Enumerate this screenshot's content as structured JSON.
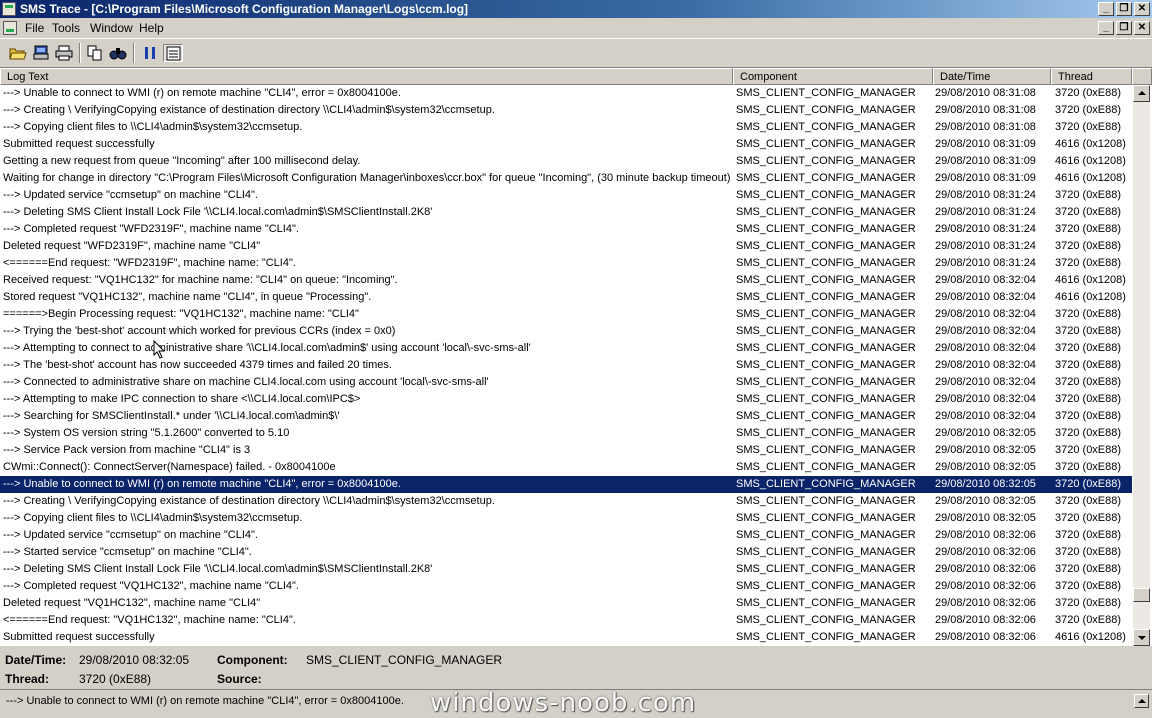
{
  "window": {
    "title": "SMS Trace - [C:\\Program Files\\Microsoft Configuration Manager\\Logs\\ccm.log]",
    "buttons": [
      "_",
      "❐",
      "✕"
    ]
  },
  "menu": {
    "items": [
      "File",
      "Tools",
      "Window",
      "Help"
    ]
  },
  "toolbar": {
    "icons": [
      "open-icon",
      "print-preview-icon",
      "print-icon",
      "copy-icon",
      "find-icon",
      "pause-icon",
      "highlight-icon"
    ]
  },
  "columns": [
    "Log Text",
    "Component",
    "Date/Time",
    "Thread"
  ],
  "rows": [
    {
      "text": "---> Unable to connect to WMI (r) on remote machine \"CLI4\", error = 0x8004100e.",
      "component": "SMS_CLIENT_CONFIG_MANAGER",
      "datetime": "29/08/2010 08:31:08",
      "thread": "3720 (0xE88)"
    },
    {
      "text": "---> Creating \\ VerifyingCopying existance of destination directory \\\\CLI4\\admin$\\system32\\ccmsetup.",
      "component": "SMS_CLIENT_CONFIG_MANAGER",
      "datetime": "29/08/2010 08:31:08",
      "thread": "3720 (0xE88)"
    },
    {
      "text": "---> Copying client files to \\\\CLI4\\admin$\\system32\\ccmsetup.",
      "component": "SMS_CLIENT_CONFIG_MANAGER",
      "datetime": "29/08/2010 08:31:08",
      "thread": "3720 (0xE88)"
    },
    {
      "text": "Submitted request successfully",
      "component": "SMS_CLIENT_CONFIG_MANAGER",
      "datetime": "29/08/2010 08:31:09",
      "thread": "4616 (0x1208)"
    },
    {
      "text": "Getting a new request from queue \"Incoming\" after 100 millisecond delay.",
      "component": "SMS_CLIENT_CONFIG_MANAGER",
      "datetime": "29/08/2010 08:31:09",
      "thread": "4616 (0x1208)"
    },
    {
      "text": "Waiting for change in directory \"C:\\Program Files\\Microsoft Configuration Manager\\inboxes\\ccr.box\" for queue \"Incoming\", (30 minute backup timeout).",
      "component": "SMS_CLIENT_CONFIG_MANAGER",
      "datetime": "29/08/2010 08:31:09",
      "thread": "4616 (0x1208)"
    },
    {
      "text": "---> Updated service \"ccmsetup\" on machine \"CLI4\".",
      "component": "SMS_CLIENT_CONFIG_MANAGER",
      "datetime": "29/08/2010 08:31:24",
      "thread": "3720 (0xE88)"
    },
    {
      "text": "---> Deleting SMS Client Install Lock File '\\\\CLI4.local.com\\admin$\\SMSClientInstall.2K8'",
      "component": "SMS_CLIENT_CONFIG_MANAGER",
      "datetime": "29/08/2010 08:31:24",
      "thread": "3720 (0xE88)"
    },
    {
      "text": "---> Completed request \"WFD2319F\", machine name \"CLI4\".",
      "component": "SMS_CLIENT_CONFIG_MANAGER",
      "datetime": "29/08/2010 08:31:24",
      "thread": "3720 (0xE88)"
    },
    {
      "text": "Deleted request \"WFD2319F\", machine name \"CLI4\"",
      "component": "SMS_CLIENT_CONFIG_MANAGER",
      "datetime": "29/08/2010 08:31:24",
      "thread": "3720 (0xE88)"
    },
    {
      "text": "<======End request: \"WFD2319F\", machine name: \"CLI4\".",
      "component": "SMS_CLIENT_CONFIG_MANAGER",
      "datetime": "29/08/2010 08:31:24",
      "thread": "3720 (0xE88)"
    },
    {
      "text": "Received request: \"VQ1HC132\" for machine name: \"CLI4\" on queue: \"Incoming\".",
      "component": "SMS_CLIENT_CONFIG_MANAGER",
      "datetime": "29/08/2010 08:32:04",
      "thread": "4616 (0x1208)"
    },
    {
      "text": "Stored request \"VQ1HC132\", machine name \"CLI4\", in queue \"Processing\".",
      "component": "SMS_CLIENT_CONFIG_MANAGER",
      "datetime": "29/08/2010 08:32:04",
      "thread": "4616 (0x1208)"
    },
    {
      "text": "======>Begin Processing request: \"VQ1HC132\", machine name: \"CLI4\"",
      "component": "SMS_CLIENT_CONFIG_MANAGER",
      "datetime": "29/08/2010 08:32:04",
      "thread": "3720 (0xE88)"
    },
    {
      "text": "---> Trying the 'best-shot' account which worked for previous CCRs (index = 0x0)",
      "component": "SMS_CLIENT_CONFIG_MANAGER",
      "datetime": "29/08/2010 08:32:04",
      "thread": "3720 (0xE88)"
    },
    {
      "text": "---> Attempting to connect to administrative share '\\\\CLI4.local.com\\admin$' using account 'local\\-svc-sms-all'",
      "component": "SMS_CLIENT_CONFIG_MANAGER",
      "datetime": "29/08/2010 08:32:04",
      "thread": "3720 (0xE88)"
    },
    {
      "text": "---> The 'best-shot' account has now succeeded 4379 times and failed 20 times.",
      "component": "SMS_CLIENT_CONFIG_MANAGER",
      "datetime": "29/08/2010 08:32:04",
      "thread": "3720 (0xE88)"
    },
    {
      "text": "---> Connected to administrative share on machine CLI4.local.com using account 'local\\-svc-sms-all'",
      "component": "SMS_CLIENT_CONFIG_MANAGER",
      "datetime": "29/08/2010 08:32:04",
      "thread": "3720 (0xE88)"
    },
    {
      "text": "---> Attempting to make IPC connection to share <\\\\CLI4.local.com\\IPC$>",
      "component": "SMS_CLIENT_CONFIG_MANAGER",
      "datetime": "29/08/2010 08:32:04",
      "thread": "3720 (0xE88)"
    },
    {
      "text": "---> Searching for SMSClientInstall.* under '\\\\CLI4.local.com\\admin$\\'",
      "component": "SMS_CLIENT_CONFIG_MANAGER",
      "datetime": "29/08/2010 08:32:04",
      "thread": "3720 (0xE88)"
    },
    {
      "text": "---> System OS version string \"5.1.2600\" converted to 5.10",
      "component": "SMS_CLIENT_CONFIG_MANAGER",
      "datetime": "29/08/2010 08:32:05",
      "thread": "3720 (0xE88)"
    },
    {
      "text": "---> Service Pack version from machine \"CLI4\" is 3",
      "component": "SMS_CLIENT_CONFIG_MANAGER",
      "datetime": "29/08/2010 08:32:05",
      "thread": "3720 (0xE88)"
    },
    {
      "text": "CWmi::Connect(): ConnectServer(Namespace) failed. - 0x8004100e",
      "component": "SMS_CLIENT_CONFIG_MANAGER",
      "datetime": "29/08/2010 08:32:05",
      "thread": "3720 (0xE88)"
    },
    {
      "text": "---> Unable to connect to WMI (r) on remote machine \"CLI4\", error = 0x8004100e.",
      "component": "SMS_CLIENT_CONFIG_MANAGER",
      "datetime": "29/08/2010 08:32:05",
      "thread": "3720 (0xE88)",
      "selected": true
    },
    {
      "text": "---> Creating \\ VerifyingCopying existance of destination directory \\\\CLI4\\admin$\\system32\\ccmsetup.",
      "component": "SMS_CLIENT_CONFIG_MANAGER",
      "datetime": "29/08/2010 08:32:05",
      "thread": "3720 (0xE88)"
    },
    {
      "text": "---> Copying client files to \\\\CLI4\\admin$\\system32\\ccmsetup.",
      "component": "SMS_CLIENT_CONFIG_MANAGER",
      "datetime": "29/08/2010 08:32:05",
      "thread": "3720 (0xE88)"
    },
    {
      "text": "---> Updated service \"ccmsetup\" on machine \"CLI4\".",
      "component": "SMS_CLIENT_CONFIG_MANAGER",
      "datetime": "29/08/2010 08:32:06",
      "thread": "3720 (0xE88)"
    },
    {
      "text": "---> Started service \"ccmsetup\" on machine \"CLI4\".",
      "component": "SMS_CLIENT_CONFIG_MANAGER",
      "datetime": "29/08/2010 08:32:06",
      "thread": "3720 (0xE88)"
    },
    {
      "text": "---> Deleting SMS Client Install Lock File '\\\\CLI4.local.com\\admin$\\SMSClientInstall.2K8'",
      "component": "SMS_CLIENT_CONFIG_MANAGER",
      "datetime": "29/08/2010 08:32:06",
      "thread": "3720 (0xE88)"
    },
    {
      "text": "---> Completed request \"VQ1HC132\", machine name \"CLI4\".",
      "component": "SMS_CLIENT_CONFIG_MANAGER",
      "datetime": "29/08/2010 08:32:06",
      "thread": "3720 (0xE88)"
    },
    {
      "text": "Deleted request \"VQ1HC132\", machine name \"CLI4\"",
      "component": "SMS_CLIENT_CONFIG_MANAGER",
      "datetime": "29/08/2010 08:32:06",
      "thread": "3720 (0xE88)"
    },
    {
      "text": "<======End request: \"VQ1HC132\", machine name: \"CLI4\".",
      "component": "SMS_CLIENT_CONFIG_MANAGER",
      "datetime": "29/08/2010 08:32:06",
      "thread": "3720 (0xE88)"
    },
    {
      "text": "Submitted request successfully",
      "component": "SMS_CLIENT_CONFIG_MANAGER",
      "datetime": "29/08/2010 08:32:06",
      "thread": "4616 (0x1208)"
    }
  ],
  "details": {
    "datetime_label": "Date/Time:",
    "datetime_value": "29/08/2010 08:32:05",
    "component_label": "Component:",
    "component_value": "SMS_CLIENT_CONFIG_MANAGER",
    "thread_label": "Thread:",
    "thread_value": "3720 (0xE88)",
    "source_label": "Source:",
    "source_value": ""
  },
  "message": "---> Unable to connect to WMI (r) on remote machine \"CLI4\", error = 0x8004100e.",
  "watermark": "windows-noob.com",
  "colors": {
    "selection": "#0a246a",
    "titlebar": "#0a246a",
    "chrome": "#d4d0c8"
  }
}
